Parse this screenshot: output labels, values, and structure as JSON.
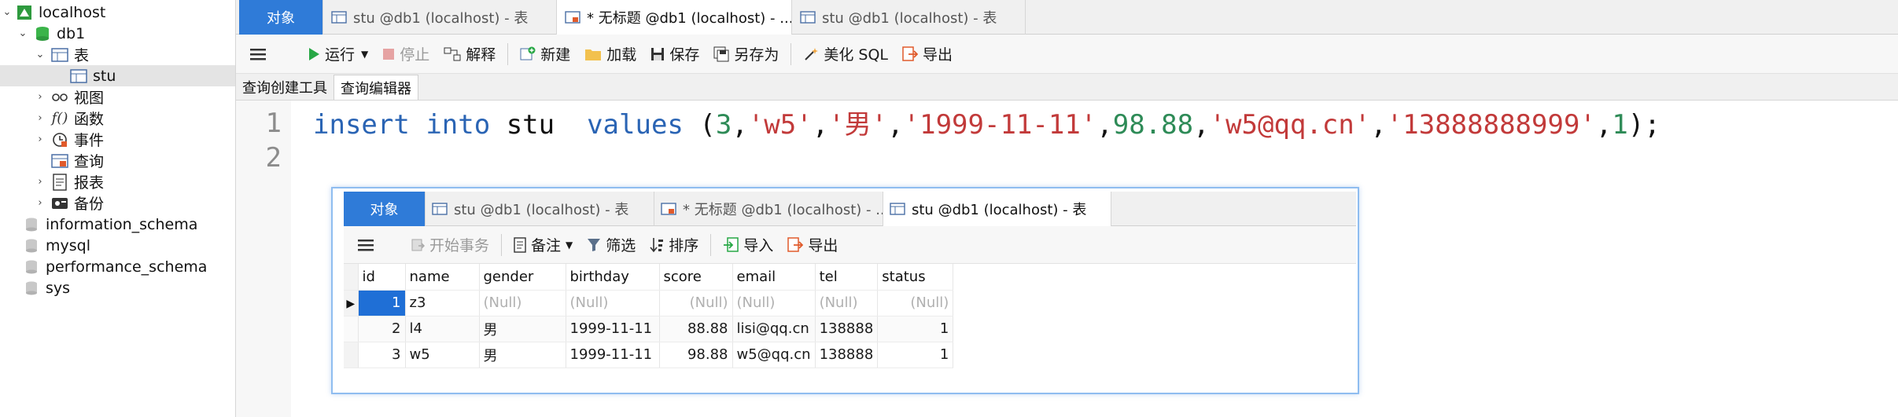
{
  "sidebar": {
    "connection": "localhost",
    "database": "db1",
    "tables_folder": "表",
    "selected_table": "stu",
    "items": [
      "视图",
      "函数",
      "事件",
      "查询",
      "报表",
      "备份"
    ],
    "other_databases": [
      "information_schema",
      "mysql",
      "performance_schema",
      "sys"
    ]
  },
  "tabs": [
    {
      "label": "对象"
    },
    {
      "label": "stu @db1 (localhost) - 表"
    },
    {
      "label": "* 无标题 @db1 (localhost) - ..."
    },
    {
      "label": "stu @db1 (localhost) - 表"
    }
  ],
  "toolbar": {
    "run": "运行",
    "stop": "停止",
    "explain": "解释",
    "new": "新建",
    "load": "加载",
    "save": "保存",
    "save_as": "另存为",
    "beautify": "美化 SQL",
    "export": "导出"
  },
  "subtabs": {
    "builder": "查询创建工具",
    "editor": "查询编辑器"
  },
  "editor": {
    "line_numbers": [
      "1",
      "2"
    ],
    "kw_insert": "insert",
    "kw_into": "into",
    "table": "stu",
    "kw_values": "values",
    "open_paren": "(",
    "v_id": "3",
    "v_name": "'w5'",
    "v_gender": "'男'",
    "v_birthday": "'1999-11-11'",
    "v_score": "98.88",
    "v_email": "'w5@qq.cn'",
    "v_tel": "'13888888999'",
    "v_status": "1",
    "comma": ",",
    "close": ");"
  },
  "popup": {
    "tabs": [
      {
        "label": "对象"
      },
      {
        "label": "stu @db1 (localhost) - 表"
      },
      {
        "label": "* 无标题 @db1 (localhost) - ..."
      },
      {
        "label": "stu @db1 (localhost) - 表"
      }
    ],
    "toolbar": {
      "begin_tx": "开始事务",
      "note": "备注",
      "filter": "筛选",
      "sort": "排序",
      "import": "导入",
      "export": "导出"
    },
    "columns": [
      "id",
      "name",
      "gender",
      "birthday",
      "score",
      "email",
      "tel",
      "status"
    ],
    "rows": [
      [
        "1",
        "z3",
        "(Null)",
        "(Null)",
        "(Null)",
        "(Null)",
        "(Null)",
        "(Null)"
      ],
      [
        "2",
        "l4",
        "男",
        "1999-11-11",
        "88.88",
        "lisi@qq.cn",
        "138888",
        "1"
      ],
      [
        "3",
        "w5",
        "男",
        "1999-11-11",
        "98.88",
        "w5@qq.cn",
        "138888",
        "1"
      ]
    ]
  }
}
